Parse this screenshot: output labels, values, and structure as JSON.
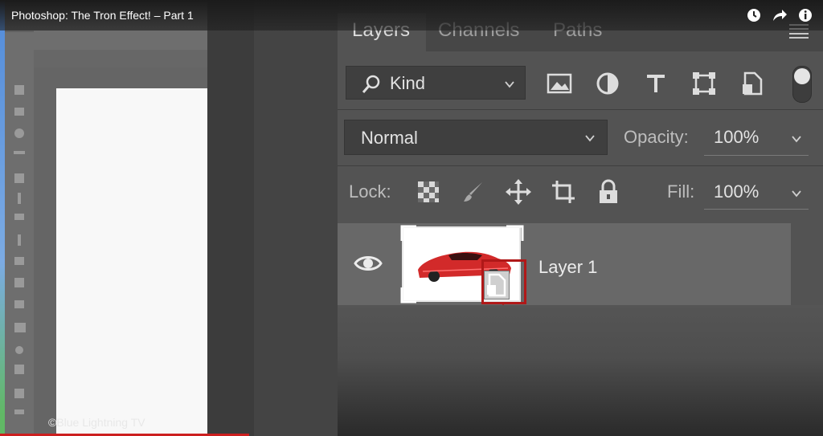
{
  "video": {
    "title": "Photoshop: The Tron Effect! – Part 1",
    "controls": [
      "watch-later-icon",
      "share-icon",
      "info-icon"
    ],
    "watermark": "©Blue Lightning TV"
  },
  "layers_panel": {
    "tabs": [
      {
        "label": "Layers",
        "active": true
      },
      {
        "label": "Channels",
        "active": false
      },
      {
        "label": "Paths",
        "active": false
      }
    ],
    "filter": {
      "label": "Kind",
      "icons": [
        "image-filter-icon",
        "adjustment-filter-icon",
        "type-filter-icon",
        "shape-filter-icon",
        "smart-object-filter-icon"
      ]
    },
    "blend_mode": "Normal",
    "opacity_label": "Opacity:",
    "opacity_value": "100%",
    "lock_label": "Lock:",
    "lock_icons": [
      "lock-transparent-pixels-icon",
      "lock-image-pixels-icon",
      "lock-position-icon",
      "lock-artboard-icon",
      "lock-all-icon"
    ],
    "fill_label": "Fill:",
    "fill_value": "100%",
    "layers": [
      {
        "name": "Layer 1",
        "visible": true,
        "smart_object": true
      }
    ]
  },
  "colors": {
    "panel_bg": "#535353",
    "selected_layer": "#686868",
    "annotation": "#b01818",
    "car": "#d22a2a"
  }
}
